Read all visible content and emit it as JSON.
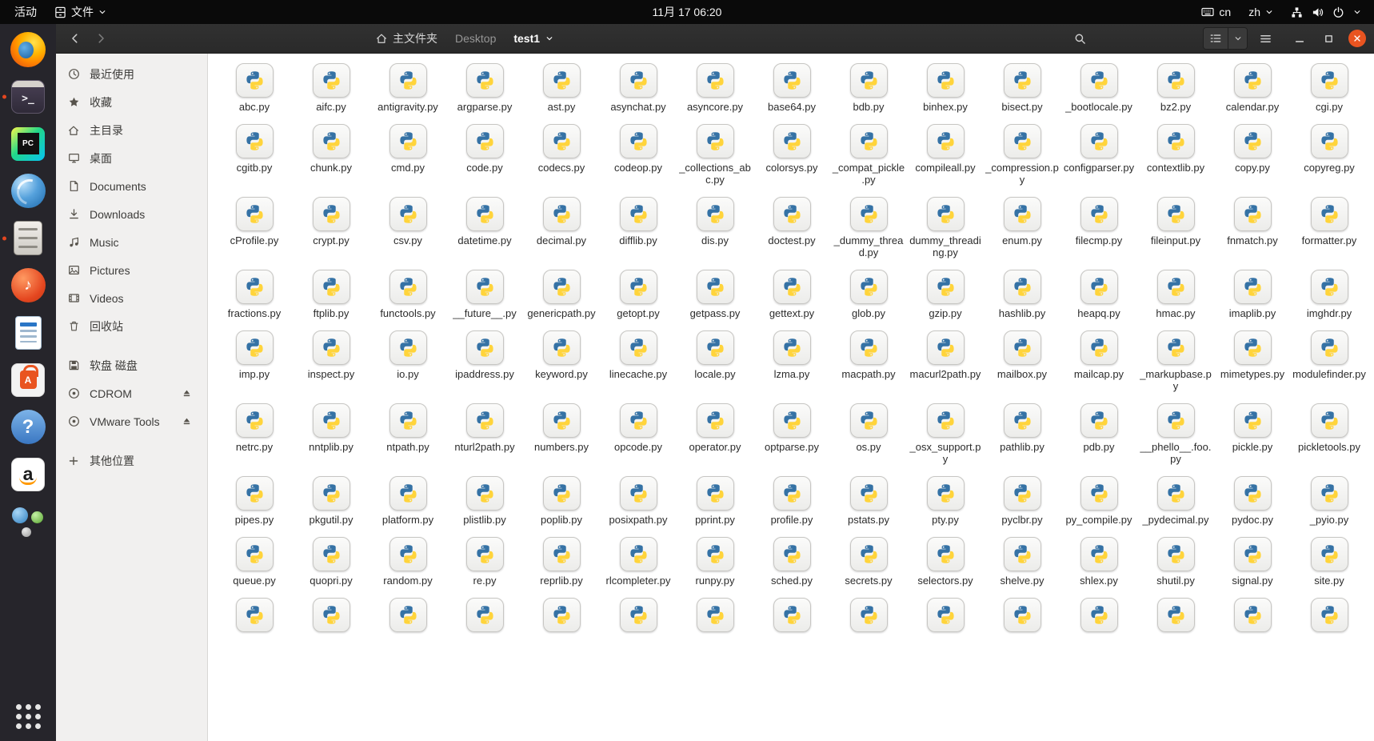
{
  "topbar": {
    "activities_label": "活动",
    "app_menu_label": "文件",
    "clock": "11月 17 06:20",
    "keyboard_layout": "cn",
    "input_source": "zh"
  },
  "dock": {
    "items": [
      {
        "id": "firefox",
        "indicator": false
      },
      {
        "id": "terminal",
        "indicator": true
      },
      {
        "id": "pycharm",
        "indicator": false
      },
      {
        "id": "blue-globe",
        "indicator": false
      },
      {
        "id": "files",
        "indicator": true
      },
      {
        "id": "rhythmbox",
        "indicator": false
      },
      {
        "id": "libreoffice-writer",
        "indicator": false
      },
      {
        "id": "ubuntu-software",
        "indicator": false
      },
      {
        "id": "help",
        "indicator": false
      },
      {
        "id": "amazon",
        "indicator": false
      },
      {
        "id": "spheres",
        "indicator": false
      }
    ]
  },
  "window": {
    "toolbar": {
      "path_home": "主文件夹",
      "path_desktop": "Desktop",
      "path_current": "test1"
    },
    "sidebar": [
      {
        "key": "recent",
        "label": "最近使用",
        "icon": "clock",
        "eject": false,
        "section_start": false
      },
      {
        "key": "starred",
        "label": "收藏",
        "icon": "star",
        "eject": false,
        "section_start": false
      },
      {
        "key": "home",
        "label": "主目录",
        "icon": "home",
        "eject": false,
        "section_start": false
      },
      {
        "key": "desktop",
        "label": "桌面",
        "icon": "desktop",
        "eject": false,
        "section_start": false
      },
      {
        "key": "documents",
        "label": "Documents",
        "icon": "document",
        "eject": false,
        "section_start": false
      },
      {
        "key": "downloads",
        "label": "Downloads",
        "icon": "download",
        "eject": false,
        "section_start": false
      },
      {
        "key": "music",
        "label": "Music",
        "icon": "music",
        "eject": false,
        "section_start": false
      },
      {
        "key": "pictures",
        "label": "Pictures",
        "icon": "image",
        "eject": false,
        "section_start": false
      },
      {
        "key": "videos",
        "label": "Videos",
        "icon": "video",
        "eject": false,
        "section_start": false
      },
      {
        "key": "trash",
        "label": "回收站",
        "icon": "trash",
        "eject": false,
        "section_start": false
      },
      {
        "key": "floppy",
        "label": "软盘 磁盘",
        "icon": "floppy",
        "eject": false,
        "section_start": true
      },
      {
        "key": "cdrom",
        "label": "CDROM",
        "icon": "disc",
        "eject": true,
        "section_start": false
      },
      {
        "key": "vmware-tools",
        "label": "VMware Tools",
        "icon": "disc",
        "eject": true,
        "section_start": false
      },
      {
        "key": "other-locations",
        "label": "其他位置",
        "icon": "plus",
        "eject": false,
        "section_start": true
      }
    ],
    "files": [
      "abc.py",
      "aifc.py",
      "antigravity.py",
      "argparse.py",
      "ast.py",
      "asynchat.py",
      "asyncore.py",
      "base64.py",
      "bdb.py",
      "binhex.py",
      "bisect.py",
      "_bootlocale.py",
      "bz2.py",
      "calendar.py",
      "cgi.py",
      "cgitb.py",
      "chunk.py",
      "cmd.py",
      "code.py",
      "codecs.py",
      "codeop.py",
      "_collections_abc.py",
      "colorsys.py",
      "_compat_pickle.py",
      "compileall.py",
      "_compression.py",
      "configparser.py",
      "contextlib.py",
      "copy.py",
      "copyreg.py",
      "cProfile.py",
      "crypt.py",
      "csv.py",
      "datetime.py",
      "decimal.py",
      "difflib.py",
      "dis.py",
      "doctest.py",
      "_dummy_thread.py",
      "dummy_threading.py",
      "enum.py",
      "filecmp.py",
      "fileinput.py",
      "fnmatch.py",
      "formatter.py",
      "fractions.py",
      "ftplib.py",
      "functools.py",
      "__future__.py",
      "genericpath.py",
      "getopt.py",
      "getpass.py",
      "gettext.py",
      "glob.py",
      "gzip.py",
      "hashlib.py",
      "heapq.py",
      "hmac.py",
      "imaplib.py",
      "imghdr.py",
      "imp.py",
      "inspect.py",
      "io.py",
      "ipaddress.py",
      "keyword.py",
      "linecache.py",
      "locale.py",
      "lzma.py",
      "macpath.py",
      "macurl2path.py",
      "mailbox.py",
      "mailcap.py",
      "_markupbase.py",
      "mimetypes.py",
      "modulefinder.py",
      "netrc.py",
      "nntplib.py",
      "ntpath.py",
      "nturl2path.py",
      "numbers.py",
      "opcode.py",
      "operator.py",
      "optparse.py",
      "os.py",
      "_osx_support.py",
      "pathlib.py",
      "pdb.py",
      "__phello__.foo.py",
      "pickle.py",
      "pickletools.py",
      "pipes.py",
      "pkgutil.py",
      "platform.py",
      "plistlib.py",
      "poplib.py",
      "posixpath.py",
      "pprint.py",
      "profile.py",
      "pstats.py",
      "pty.py",
      "pyclbr.py",
      "py_compile.py",
      "_pydecimal.py",
      "pydoc.py",
      "_pyio.py",
      "queue.py",
      "quopri.py",
      "random.py",
      "re.py",
      "reprlib.py",
      "rlcompleter.py",
      "runpy.py",
      "sched.py",
      "secrets.py",
      "selectors.py",
      "shelve.py",
      "shlex.py",
      "shutil.py",
      "signal.py",
      "site.py"
    ],
    "partial_row_count": 15
  },
  "colors": {
    "ubuntu_orange": "#e95420",
    "python_blue": "#3572a5",
    "python_yellow": "#ffd43b",
    "header_bg": "#2e2e2e",
    "sidebar_bg": "#f1f0ef",
    "topbar_bg": "#0a0a0a"
  }
}
